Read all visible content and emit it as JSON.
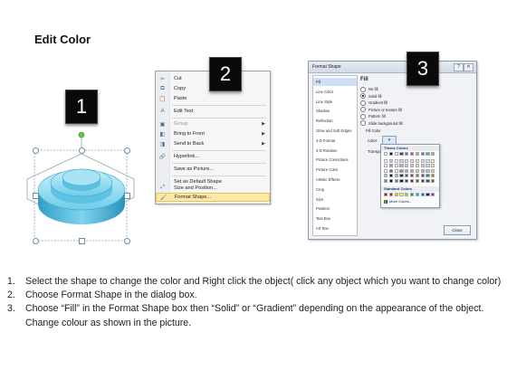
{
  "header": {
    "title": "Edit Color"
  },
  "badges": [
    "1",
    "2",
    "3"
  ],
  "context_menu": {
    "items": [
      {
        "icon": "scissors-icon",
        "glyph": "✂",
        "label": "Cut",
        "has_submenu": false,
        "disabled": false
      },
      {
        "icon": "copy-icon",
        "glyph": "⧉",
        "label": "Copy",
        "has_submenu": false,
        "disabled": false
      },
      {
        "icon": "paste-icon",
        "glyph": "📋",
        "label": "Paste",
        "has_submenu": false,
        "disabled": false
      },
      {
        "icon": "edit-text-icon",
        "glyph": "A",
        "label": "Edit Text",
        "has_submenu": false,
        "disabled": false
      },
      {
        "icon": "group-icon",
        "glyph": "▣",
        "label": "Group",
        "has_submenu": true,
        "disabled": true
      },
      {
        "icon": "bring-front-icon",
        "glyph": "◧",
        "label": "Bring to Front",
        "has_submenu": true,
        "disabled": false
      },
      {
        "icon": "send-back-icon",
        "glyph": "◨",
        "label": "Send to Back",
        "has_submenu": true,
        "disabled": false
      },
      {
        "icon": "hyperlink-icon",
        "glyph": "🔗",
        "label": "Hyperlink...",
        "has_submenu": false,
        "disabled": false
      },
      {
        "icon": "",
        "glyph": "",
        "label": "Save as Picture...",
        "has_submenu": false,
        "disabled": false
      },
      {
        "icon": "",
        "glyph": "",
        "label": "Set as Default Shape",
        "has_submenu": false,
        "disabled": false
      },
      {
        "icon": "size-position-icon",
        "glyph": "⤢",
        "label": "Size and Position...",
        "has_submenu": false,
        "disabled": false
      },
      {
        "icon": "format-shape-icon",
        "glyph": "🖌",
        "label": "Format Shape...",
        "has_submenu": false,
        "disabled": false,
        "highlighted": true
      }
    ]
  },
  "format_dialog": {
    "title": "Format Shape",
    "nav_items": [
      "Fill",
      "Line Color",
      "Line Style",
      "Shadow",
      "Reflection",
      "Glow and Soft Edges",
      "3-D Format",
      "3-D Rotation",
      "Picture Corrections",
      "Picture Color",
      "Artistic Effects",
      "Crop",
      "Size",
      "Position",
      "Text Box",
      "Alt Text"
    ],
    "selected_nav": "Fill",
    "pane_heading": "Fill",
    "fill_options": [
      {
        "label": "No fill",
        "selected": false
      },
      {
        "label": "Solid fill",
        "selected": true
      },
      {
        "label": "Gradient fill",
        "selected": false
      },
      {
        "label": "Picture or texture fill",
        "selected": false
      },
      {
        "label": "Pattern fill",
        "selected": false
      },
      {
        "label": "Slide background fill",
        "selected": false
      }
    ],
    "fill_color_label": "Fill Color",
    "color_label": "Color:",
    "transparency_label": "Transpa",
    "close_label": "Close"
  },
  "color_palette": {
    "theme_label": "Theme Colors",
    "standard_label": "Standard Colors",
    "more_label": "More Colors...",
    "theme_columns": [
      "#ffffff",
      "#000000",
      "#eeece1",
      "#1f497d",
      "#4f81bd",
      "#c0504d",
      "#9bbb59",
      "#8064a2",
      "#4bacc6",
      "#f79646"
    ],
    "standard_colors": [
      "#c00000",
      "#ff0000",
      "#ffc000",
      "#ffff00",
      "#92d050",
      "#00b050",
      "#00b0f0",
      "#0070c0",
      "#002060",
      "#7030a0"
    ]
  },
  "instructions": [
    {
      "num": "1.",
      "text": "Select the shape to change the color and Right click the object( click any object which you want to change color)"
    },
    {
      "num": "2.",
      "text": "Choose Format Shape in the dialog box."
    },
    {
      "num": "3.",
      "text": "Choose “Fill” in the Format Shape box then “Solid” or “Gradient” depending on the appearance of the object. Change colour as shown in the picture."
    }
  ]
}
